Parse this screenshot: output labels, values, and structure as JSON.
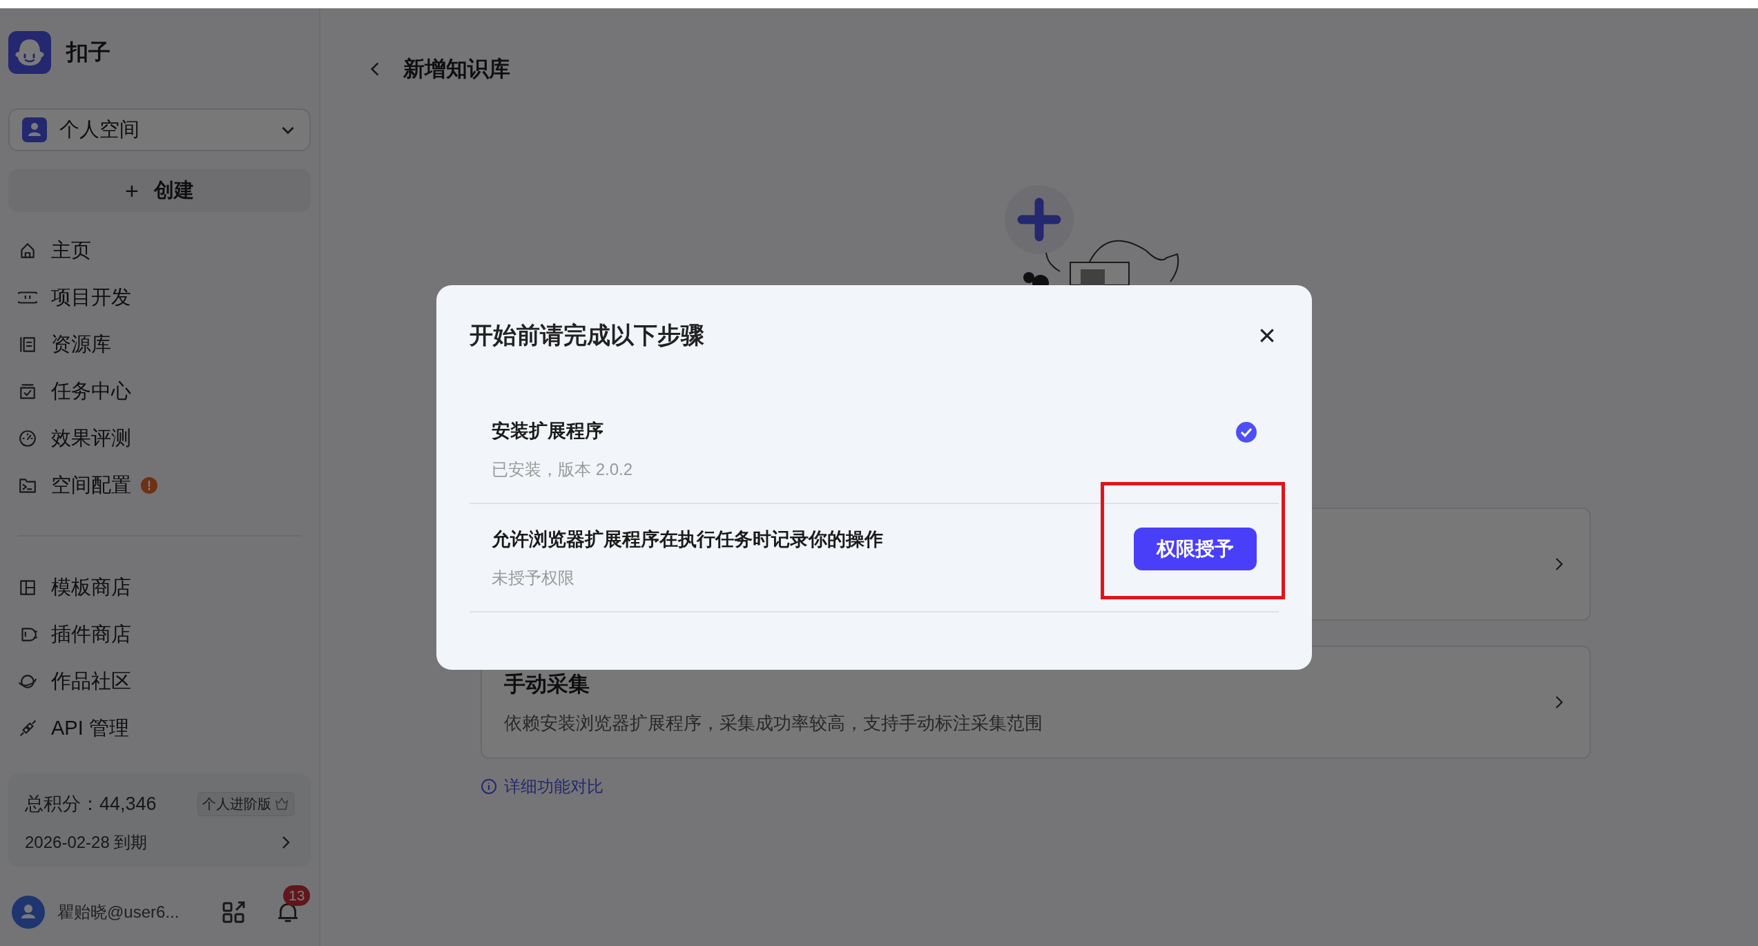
{
  "sidebar": {
    "app_name": "扣子",
    "workspace": "个人空间",
    "create_button": {
      "icon": "+",
      "label": "创建"
    },
    "nav_groups": [
      [
        {
          "label": "主页",
          "alert": false
        },
        {
          "label": "项目开发",
          "alert": false
        },
        {
          "label": "资源库",
          "alert": false
        },
        {
          "label": "任务中心",
          "alert": false
        },
        {
          "label": "效果评测",
          "alert": false
        },
        {
          "label": "空间配置",
          "alert": true
        }
      ],
      [
        {
          "label": "模板商店",
          "alert": false
        },
        {
          "label": "插件商店",
          "alert": false
        },
        {
          "label": "作品社区",
          "alert": false
        },
        {
          "label": "API 管理",
          "alert": false
        }
      ]
    ],
    "credits": {
      "total": "总积分：44,346",
      "plan": "个人进阶版",
      "expiry": "2026-02-28 到期"
    },
    "user": {
      "name": "瞿贻晓@user6..."
    },
    "notifications": {
      "count": "13"
    }
  },
  "main": {
    "title": "新增知识库",
    "options": [
      {
        "title": "手动采集",
        "description": "依赖安装浏览器扩展程序，采集成功率较高，支持手动标注采集范围"
      }
    ],
    "compare_link": "详细功能对比"
  },
  "dialog": {
    "title": "开始前请完成以下步骤",
    "steps": [
      {
        "title": "安装扩展程序",
        "status": "已安装，版本 2.0.2",
        "completed": true
      },
      {
        "title": "允许浏览器扩展程序在执行任务时记录你的操作",
        "status": "未授予权限",
        "completed": false,
        "action": "权限授予",
        "highlighted": true
      }
    ]
  }
}
